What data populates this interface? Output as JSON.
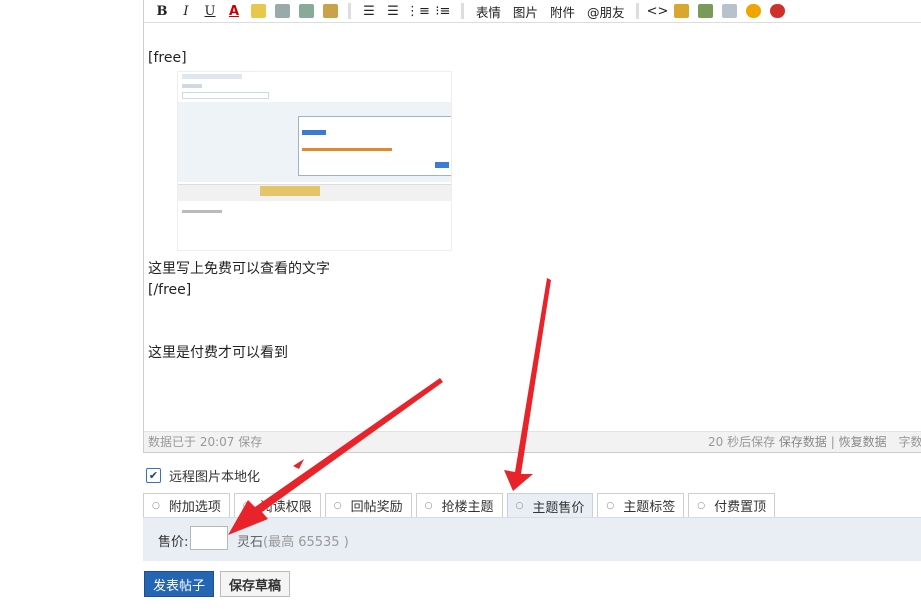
{
  "toolbar": {
    "emoji_label": "表情",
    "image_label": "图片",
    "attach_label": "附件",
    "mention_label": "@朋友"
  },
  "content": {
    "free_open": "[free]",
    "free_text": "这里写上免费可以查看的文字",
    "free_close": "[/free]",
    "paid_text": "这里是付费才可以看到"
  },
  "status": {
    "saved_at": "数据已于 20:07 保存",
    "autosave": "20 秒后保存",
    "save_data": "保存数据",
    "restore_data": "恢复数据",
    "char_count": "字数"
  },
  "remote_images": {
    "label": "远程图片本地化",
    "checked": true
  },
  "tabs": [
    {
      "label": "附加选项"
    },
    {
      "label": "阅读权限"
    },
    {
      "label": "回帖奖励"
    },
    {
      "label": "抢楼主题"
    },
    {
      "label": "主题售价"
    },
    {
      "label": "主题标签"
    },
    {
      "label": "付费置顶"
    }
  ],
  "active_tab": "主题售价",
  "price_panel": {
    "label": "售价:",
    "value": "",
    "unit": "灵石",
    "hint": "(最高 65535 )"
  },
  "buttons": {
    "post": "发表帖子",
    "draft": "保存草稿"
  },
  "colors": {
    "primary_button": "#2465b4",
    "panel_bg": "#e8eef4",
    "arrow": "#e8232a"
  }
}
